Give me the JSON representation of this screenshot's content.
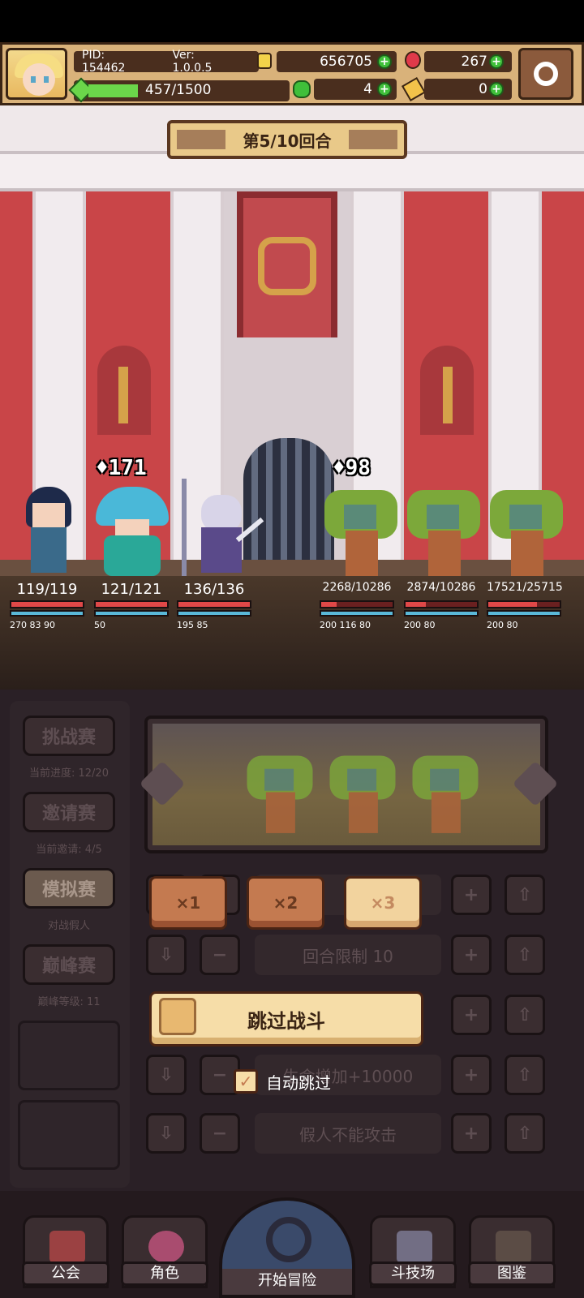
{
  "header": {
    "pid": "PID: 154462",
    "version": "Ver: 1.0.0.5",
    "exp": "457/1500",
    "exp_fraction": 0.305,
    "gold": "656705",
    "ruby": "267",
    "clover": "4",
    "key": "0",
    "colors": {
      "gold": "#f2d34a",
      "ruby": "#e03a4a",
      "clover": "#3fbf3a",
      "key": "#f2c24a"
    }
  },
  "battle": {
    "round_label": "第5/10回合",
    "hero_damage": "171",
    "enemy_damage": "98"
  },
  "units": [
    {
      "hp": "119/119",
      "hp_frac": 1.0,
      "buffs": "270 83 90"
    },
    {
      "hp": "121/121",
      "hp_frac": 1.0,
      "buffs": "50"
    },
    {
      "hp": "136/136",
      "hp_frac": 1.0,
      "buffs": "195 85"
    },
    {
      "hp": "2268/10286",
      "hp_frac": 0.22,
      "buffs": "200 116 80"
    },
    {
      "hp": "2874/10286",
      "hp_frac": 0.28,
      "buffs": "200 80"
    },
    {
      "hp": "17521/25715",
      "hp_frac": 0.68,
      "buffs": "200 80"
    }
  ],
  "sidebar": {
    "challenge": {
      "label": "挑战赛",
      "sub": "当前进度: 12/20"
    },
    "invite": {
      "label": "邀请赛",
      "sub": "当前邀请: 4/5"
    },
    "sim": {
      "label": "模拟赛",
      "sub": "对战假人"
    },
    "peak": {
      "label": "巅峰赛",
      "sub": "巅峰等级: 11"
    }
  },
  "controls": {
    "speed": [
      "×1",
      "×2",
      "×3"
    ],
    "speed_selected": "×3",
    "round_limit": "回合限制 10",
    "hp_bonus": "生命增加+10000",
    "dummy_no_attack": "假人不能攻击",
    "skip_battle": "跳过战斗",
    "auto_skip": "自动跳过",
    "auto_skip_checked": true
  },
  "nav": {
    "guild": "公会",
    "character": "角色",
    "start": "开始冒险",
    "arena": "斗技场",
    "codex": "图鉴"
  }
}
